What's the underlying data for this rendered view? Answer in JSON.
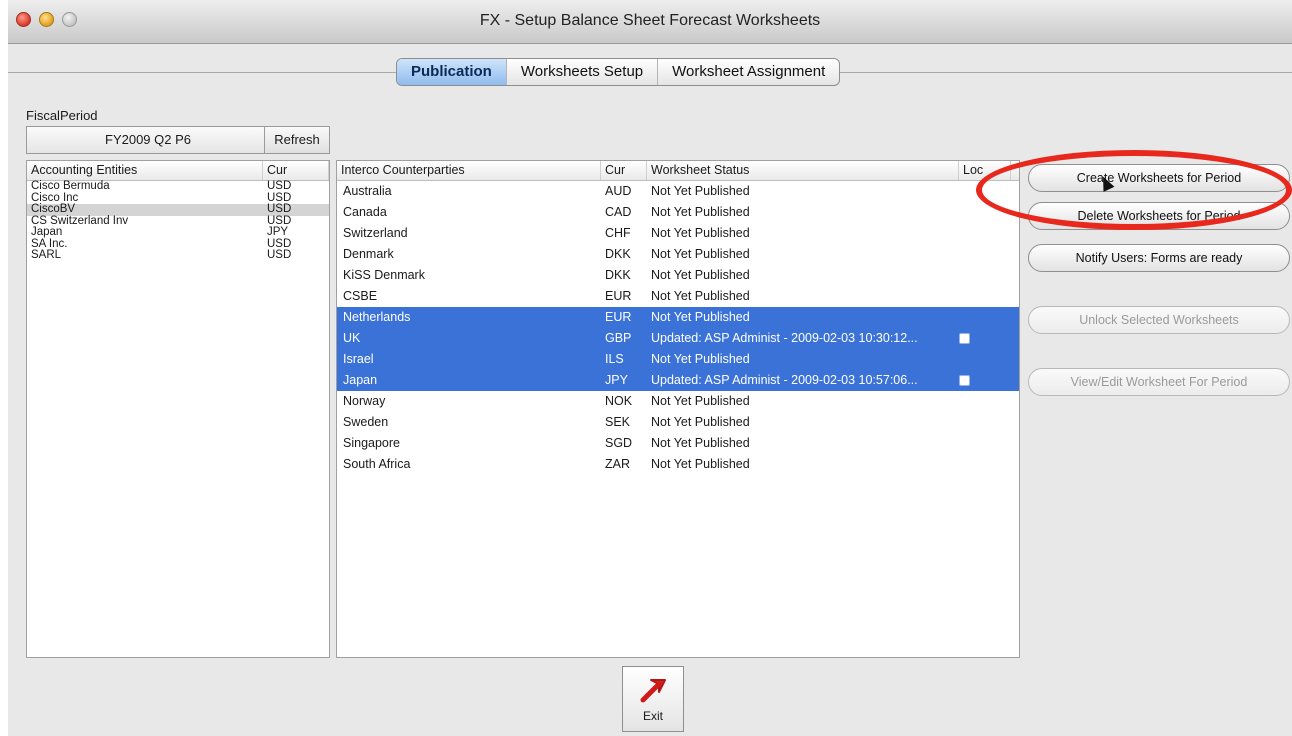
{
  "window": {
    "title": "FX - Setup Balance Sheet Forecast Worksheets"
  },
  "tabs": [
    {
      "label": "Publication",
      "active": true
    },
    {
      "label": "Worksheets Setup",
      "active": false
    },
    {
      "label": "Worksheet Assignment",
      "active": false
    }
  ],
  "fiscal_period": {
    "label": "FiscalPeriod",
    "value": "FY2009 Q2 P6",
    "refresh_label": "Refresh"
  },
  "entities": {
    "headers": {
      "name": "Accounting Entities",
      "cur": "Cur"
    },
    "rows": [
      {
        "name": "Cisco Bermuda",
        "cur": "USD",
        "selected": false
      },
      {
        "name": "Cisco Inc",
        "cur": "USD",
        "selected": false
      },
      {
        "name": "CiscoBV",
        "cur": "USD",
        "selected": true
      },
      {
        "name": "CS Switzerland Inv",
        "cur": "USD",
        "selected": false
      },
      {
        "name": "Japan",
        "cur": "JPY",
        "selected": false
      },
      {
        "name": "SA Inc.",
        "cur": "USD",
        "selected": false
      },
      {
        "name": "SARL",
        "cur": "USD",
        "selected": false
      }
    ]
  },
  "counterparties": {
    "headers": {
      "name": "Interco Counterparties",
      "cur": "Cur",
      "status": "Worksheet Status",
      "lock": "Loc"
    },
    "rows": [
      {
        "name": "Australia",
        "cur": "AUD",
        "status": "Not Yet Published",
        "selected": false,
        "locked": false
      },
      {
        "name": "Canada",
        "cur": "CAD",
        "status": "Not Yet Published",
        "selected": false,
        "locked": false
      },
      {
        "name": "Switzerland",
        "cur": "CHF",
        "status": "Not Yet Published",
        "selected": false,
        "locked": false
      },
      {
        "name": "Denmark",
        "cur": "DKK",
        "status": "Not Yet Published",
        "selected": false,
        "locked": false
      },
      {
        "name": "KiSS Denmark",
        "cur": "DKK",
        "status": "Not Yet Published",
        "selected": false,
        "locked": false
      },
      {
        "name": "CSBE",
        "cur": "EUR",
        "status": "Not Yet Published",
        "selected": false,
        "locked": false
      },
      {
        "name": "Netherlands",
        "cur": "EUR",
        "status": "Not Yet Published",
        "selected": true,
        "locked": false
      },
      {
        "name": "UK",
        "cur": "GBP",
        "status": "Updated: ASP Administ - 2009-02-03 10:30:12...",
        "selected": true,
        "locked": true
      },
      {
        "name": "Israel",
        "cur": "ILS",
        "status": "Not Yet Published",
        "selected": true,
        "locked": false
      },
      {
        "name": "Japan",
        "cur": "JPY",
        "status": "Updated: ASP Administ - 2009-02-03 10:57:06...",
        "selected": true,
        "locked": true
      },
      {
        "name": "Norway",
        "cur": "NOK",
        "status": "Not Yet Published",
        "selected": false,
        "locked": false
      },
      {
        "name": "Sweden",
        "cur": "SEK",
        "status": "Not Yet Published",
        "selected": false,
        "locked": false
      },
      {
        "name": "Singapore",
        "cur": "SGD",
        "status": "Not Yet Published",
        "selected": false,
        "locked": false
      },
      {
        "name": "South Africa",
        "cur": "ZAR",
        "status": "Not Yet Published",
        "selected": false,
        "locked": false
      }
    ]
  },
  "actions": {
    "create": "Create Worksheets for Period",
    "delete": "Delete Worksheets for Period",
    "notify": "Notify Users: Forms are ready",
    "unlock": "Unlock Selected Worksheets",
    "view_edit": "View/Edit Worksheet For Period"
  },
  "exit": {
    "label": "Exit",
    "icon": "exit-arrow-icon"
  },
  "colors": {
    "selection": "#3a72d8",
    "annotation": "#e8281c",
    "active_tab": "#8fbcee"
  }
}
